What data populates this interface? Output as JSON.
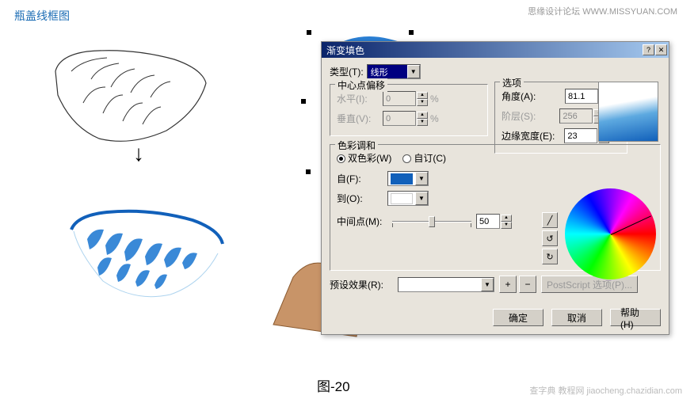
{
  "labels": {
    "top_left": "瓶盖线框图",
    "top_right": "思缘设计论坛 WWW.MISSYUAN.COM",
    "figure": "图-20",
    "bottom_wm": "查字典 教程网\njiaocheng.chazidian.com"
  },
  "dialog": {
    "title": "渐变填色",
    "type_label": "类型(T):",
    "type_value": "线形",
    "center_group": "中心点偏移",
    "horiz_label": "水平(I):",
    "horiz_value": "0",
    "vert_label": "垂直(V):",
    "vert_value": "0",
    "percent": "%",
    "options_group": "选项",
    "angle_label": "角度(A):",
    "angle_value": "81.1",
    "steps_label": "阶层(S):",
    "steps_value": "256",
    "edge_label": "边缘宽度(E):",
    "edge_value": "23",
    "blend_group": "色彩调和",
    "bicolor_label": "双色彩(W)",
    "custom_label": "自订(C)",
    "from_label": "自(F):",
    "to_label": "到(O):",
    "midpoint_label": "中间点(M):",
    "midpoint_value": "50",
    "preset_label": "预设效果(R):",
    "postscript_btn": "PostScript 选项(P)...",
    "ok": "确定",
    "cancel": "取消",
    "help": "帮助(H)"
  }
}
